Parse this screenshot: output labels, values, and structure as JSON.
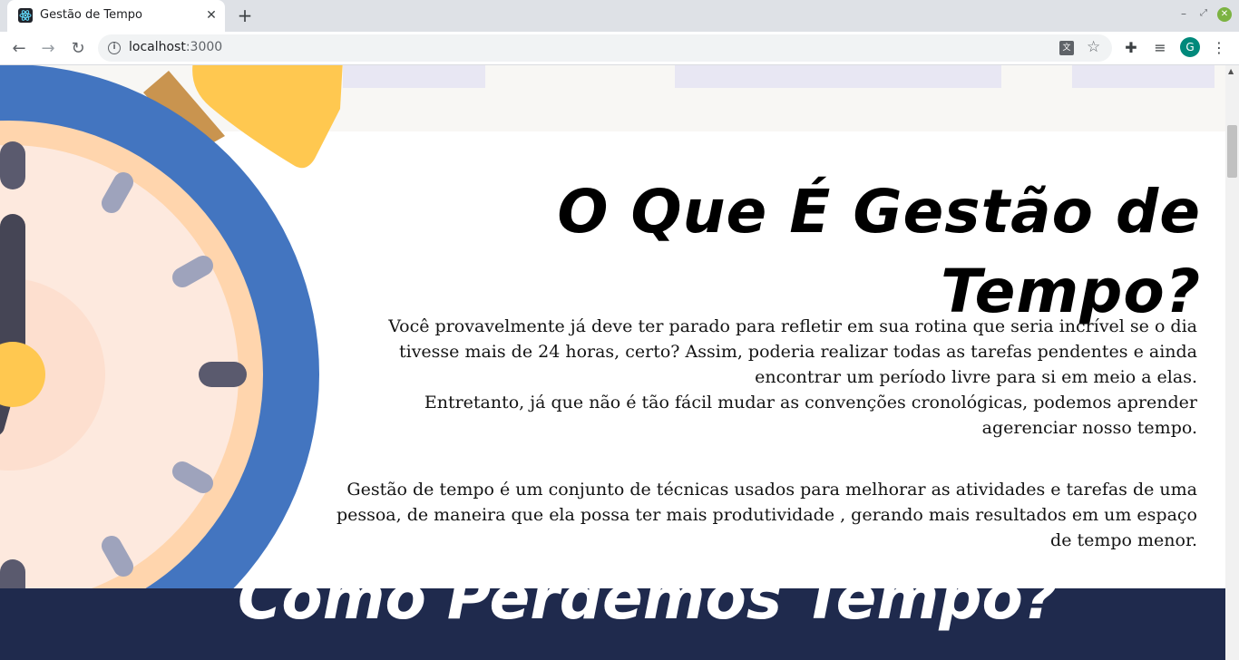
{
  "browser": {
    "tab_title": "Gestão de Tempo",
    "url_host": "localhost",
    "url_port": ":3000",
    "profile_initial": "G"
  },
  "colors": {
    "clock_ring": "#4375c0",
    "clock_rim": "#ffd5ad",
    "clock_face": "#fde9de",
    "clock_bell": "#ffc850",
    "dark_section": "#1f2a4d"
  },
  "article": {
    "title": "O Que É Gestão de Tempo?",
    "paragraph_1_line_1": "Você provavelmente já deve ter parado para refletir em sua rotina que seria incrível se o dia tivesse mais de 24 horas, certo? Assim, poderia realizar todas as tarefas pendentes e ainda encontrar um período livre para si em meio a elas.",
    "paragraph_1_line_2": "Entretanto, já que não é tão fácil mudar as convenções cronológicas, podemos aprender agerenciar nosso tempo.",
    "paragraph_2": "Gestão de tempo é um conjunto de técnicas usados para melhorar as atividades e tarefas de uma pessoa, de maneira que ela possa ter mais produtividade , gerando mais resultados em um espaço de tempo menor."
  },
  "next_section": {
    "title": "Como Perdemos Tempo?"
  }
}
